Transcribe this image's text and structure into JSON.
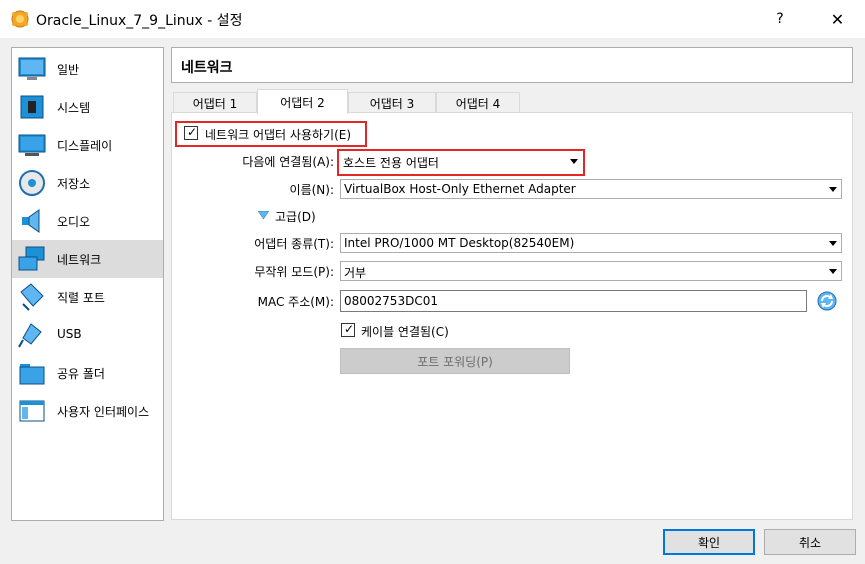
{
  "window": {
    "title": "Oracle_Linux_7_9_Linux - 설정",
    "help_label": "?",
    "close_label": "✕"
  },
  "sidebar": {
    "items": [
      {
        "label": "일반",
        "icon": "monitor-general-icon"
      },
      {
        "label": "시스템",
        "icon": "chip-icon"
      },
      {
        "label": "디스플레이",
        "icon": "display-icon"
      },
      {
        "label": "저장소",
        "icon": "disk-icon"
      },
      {
        "label": "오디오",
        "icon": "speaker-icon"
      },
      {
        "label": "네트워크",
        "icon": "network-icon"
      },
      {
        "label": "직렬 포트",
        "icon": "serial-port-icon"
      },
      {
        "label": "USB",
        "icon": "usb-icon"
      },
      {
        "label": "공유 폴더",
        "icon": "folder-icon"
      },
      {
        "label": "사용자 인터페이스",
        "icon": "window-icon"
      }
    ],
    "active_index": 5
  },
  "main": {
    "title": "네트워크",
    "tabs": [
      "어댑터 1",
      "어댑터 2",
      "어댑터 3",
      "어댑터 4"
    ],
    "active_tab": 1,
    "enable_adapter": {
      "label": "네트워크 어댑터 사용하기(E)",
      "checked": true
    },
    "attached_to": {
      "label": "다음에 연결됨(A):",
      "value": "호스트 전용 어댑터"
    },
    "name": {
      "label": "이름(N):",
      "value": "VirtualBox Host-Only Ethernet Adapter"
    },
    "advanced": {
      "label": "고급(D)"
    },
    "adapter_type": {
      "label": "어댑터 종류(T):",
      "value": "Intel PRO/1000 MT Desktop(82540EM)"
    },
    "promiscuous": {
      "label": "무작위 모드(P):",
      "value": "거부"
    },
    "mac": {
      "label": "MAC 주소(M):",
      "value": "08002753DC01"
    },
    "cable": {
      "label": "케이블 연결됨(C)",
      "checked": true
    },
    "port_forwarding": {
      "label": "포트 포워딩(P)"
    }
  },
  "footer": {
    "ok_label": "확인",
    "cancel_label": "취소"
  },
  "colors": {
    "highlight_box": "#e32626",
    "primary_border": "#0078d7",
    "active_sidebar": "#dcdcdc"
  }
}
